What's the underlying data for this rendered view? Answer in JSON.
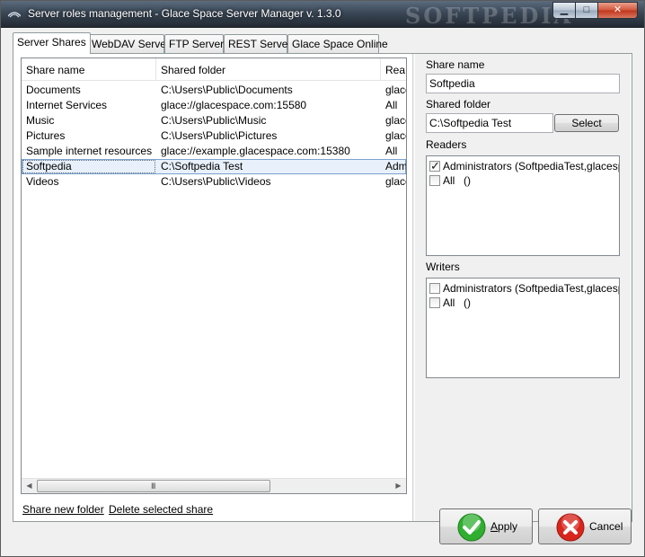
{
  "window": {
    "title": "Server roles management - Glace Space Server Manager v. 1.3.0",
    "watermark": "SOFTPEDIA",
    "minimize_icon": "minimize-icon",
    "maximize_icon": "maximize-icon",
    "close_icon": "close-icon"
  },
  "tabs": [
    {
      "label": "Server Shares",
      "active": true
    },
    {
      "label": "WebDAV Server"
    },
    {
      "label": "FTP Server"
    },
    {
      "label": "REST Server"
    },
    {
      "label": "Glace Space Online"
    }
  ],
  "shares": {
    "columns": [
      "Share name",
      "Shared folder",
      "Rea"
    ],
    "rows": [
      {
        "name": "Documents",
        "folder": "C:\\Users\\Public\\Documents",
        "readers": "glace"
      },
      {
        "name": "Internet Services",
        "folder": "glace://glacespace.com:15580",
        "readers": "All"
      },
      {
        "name": "Music",
        "folder": "C:\\Users\\Public\\Music",
        "readers": "glace"
      },
      {
        "name": "Pictures",
        "folder": "C:\\Users\\Public\\Pictures",
        "readers": "glace"
      },
      {
        "name": "Sample internet resources",
        "folder": "glace://example.glacespace.com:15380",
        "readers": "All"
      },
      {
        "name": "Softpedia",
        "folder": "C:\\Softpedia Test",
        "readers": "Adm",
        "selected": true
      },
      {
        "name": "Videos",
        "folder": "C:\\Users\\Public\\Videos",
        "readers": "glace"
      }
    ],
    "scroll_grip": "III"
  },
  "links": {
    "share_new": "Share new folder",
    "delete_selected": "Delete selected share"
  },
  "details": {
    "share_name_label": "Share name",
    "share_name_value": "Softpedia",
    "shared_folder_label": "Shared folder",
    "shared_folder_value": "C:\\Softpedia Test",
    "select_button": "Select",
    "readers_label": "Readers",
    "readers": [
      {
        "name": "Administrators",
        "detail": "(SoftpediaTest,glacespa",
        "checked": true
      },
      {
        "name": "All",
        "detail": "()",
        "checked": false
      }
    ],
    "writers_label": "Writers",
    "writers": [
      {
        "name": "Administrators",
        "detail": "(SoftpediaTest,glacespa",
        "checked": false
      },
      {
        "name": "All",
        "detail": "()",
        "checked": false
      }
    ]
  },
  "footer": {
    "apply_label": "Apply",
    "apply_mnemonic": "A",
    "apply_rest": "pply",
    "apply_icon": "check-icon",
    "cancel_label": "Cancel",
    "cancel_icon": "cross-icon"
  },
  "colors": {
    "apply_green": "#2fae2f",
    "cancel_red": "#d8261d",
    "selection": "#e8f1fb"
  }
}
